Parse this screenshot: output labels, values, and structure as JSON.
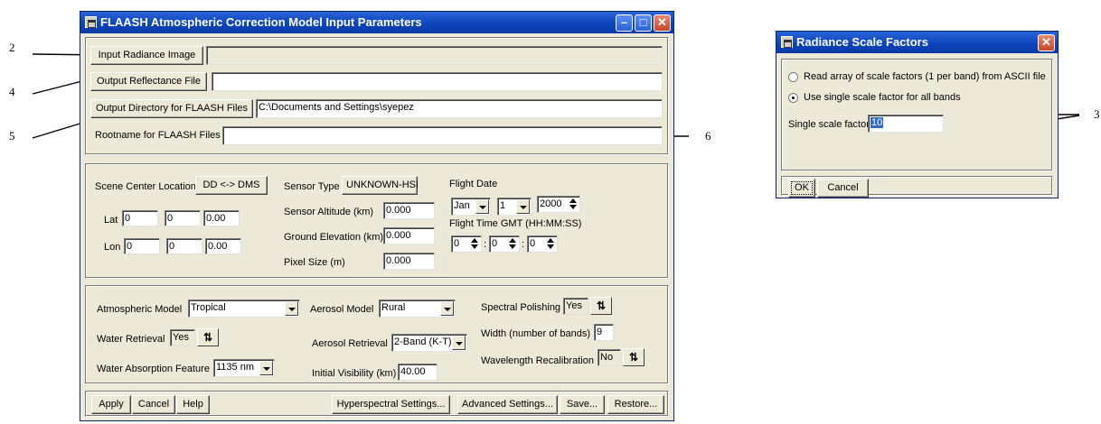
{
  "callouts": {
    "n2": "2",
    "n4": "4",
    "n5": "5",
    "n6": "6",
    "n3": "3"
  },
  "main": {
    "title": "FLAASH Atmospheric Correction Model Input Parameters",
    "files": {
      "input_radiance_button": "Input Radiance Image",
      "input_radiance_value": "",
      "output_reflectance_button": "Output Reflectance File",
      "output_reflectance_value": "",
      "output_directory_button": "Output Directory for FLAASH Files",
      "output_directory_value": "C:\\Documents and Settings\\syepez",
      "rootname_label": "Rootname for FLAASH Files",
      "rootname_value": ""
    },
    "scene": {
      "center_label": "Scene Center Location",
      "ddms_button": "DD <-> DMS",
      "lat_label": "Lat",
      "lat": [
        "0",
        "0",
        "0.00"
      ],
      "lon_label": "Lon",
      "lon": [
        "0",
        "0",
        "0.00"
      ],
      "sensor_type_label": "Sensor Type",
      "sensor_type_button": "UNKNOWN-HSI",
      "sensor_altitude_label": "Sensor Altitude (km)",
      "sensor_altitude": "0.000",
      "ground_elevation_label": "Ground Elevation (km)",
      "ground_elevation": "0.000",
      "pixel_size_label": "Pixel Size (m)",
      "pixel_size": "0.000",
      "flight_date_label": "Flight Date",
      "month": "Jan",
      "day": "1",
      "year": "2000",
      "flight_time_label": "Flight Time GMT (HH:MM:SS)",
      "hh": "0",
      "mm": "0",
      "ss": "0",
      "colon": ":"
    },
    "model": {
      "atmospheric_model_label": "Atmospheric Model",
      "atmospheric_model": "Tropical",
      "water_retrieval_label": "Water Retrieval",
      "water_retrieval": "Yes",
      "water_absorption_label": "Water Absorption Feature",
      "water_absorption": "1135 nm",
      "aerosol_model_label": "Aerosol Model",
      "aerosol_model": "Rural",
      "aerosol_retrieval_label": "Aerosol Retrieval",
      "aerosol_retrieval": "2-Band (K-T)",
      "initial_visibility_label": "Initial Visibility (km)",
      "initial_visibility": "40.00",
      "spectral_polishing_label": "Spectral Polishing",
      "spectral_polishing": "Yes",
      "width_label": "Width (number of bands)",
      "width": "9",
      "wavelength_recal_label": "Wavelength Recalibration",
      "wavelength_recal": "No",
      "toggle_glyph": "⇅"
    },
    "buttons": {
      "apply": "Apply",
      "cancel": "Cancel",
      "help": "Help",
      "hyperspectral": "Hyperspectral Settings...",
      "advanced": "Advanced Settings...",
      "save": "Save...",
      "restore": "Restore..."
    }
  },
  "dialog": {
    "title": "Radiance Scale Factors",
    "radio_ascii": "Read array of scale factors (1 per band) from ASCII file",
    "radio_single": "Use single scale factor for all bands",
    "single_label": "Single scale factor",
    "single_value": "10",
    "ok": "OK",
    "cancel": "Cancel"
  }
}
